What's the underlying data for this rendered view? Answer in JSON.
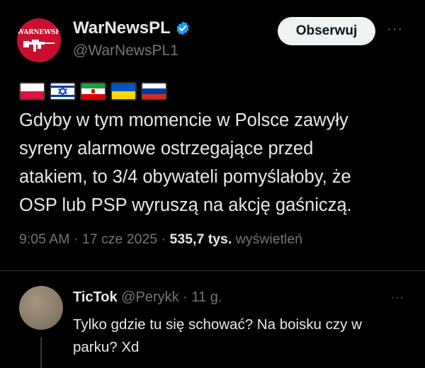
{
  "tweet": {
    "avatar_logo_text": "WARNEWSPL",
    "author_name": "WarNewsPL",
    "author_handle": "@WarNewsPL1",
    "follow_label": "Obserwuj",
    "more_label": "···",
    "flags": [
      "Poland",
      "Israel",
      "Iran",
      "Ukraine",
      "Russia"
    ],
    "text_lines": [
      "Gdyby w tym momencie w Polsce zawyły",
      "syreny alarmowe ostrzegające przed",
      "atakiem, to  3/4 obywateli pomyślałoby, że",
      "OSP lub PSP wyruszą na akcję gaśniczą."
    ],
    "time": "9:05 AM",
    "date": "17 cze 2025",
    "views_count": "535,7 tys.",
    "views_label": "wyświetleń",
    "separator": "·"
  },
  "reply": {
    "author_name": "TicTok",
    "author_handle": "@Perykk",
    "time_ago": "11 g.",
    "separator": "·",
    "more_label": "···",
    "text_lines": [
      "Tylko gdzie tu się schować? Na boisku czy w",
      "parku? Xd"
    ]
  },
  "colors": {
    "background": "#000000",
    "text_primary": "#e7e9ea",
    "text_secondary": "#71767b",
    "verified_blue": "#1d9bf0",
    "avatar_red": "#c8102e",
    "divider": "#2f3336"
  }
}
